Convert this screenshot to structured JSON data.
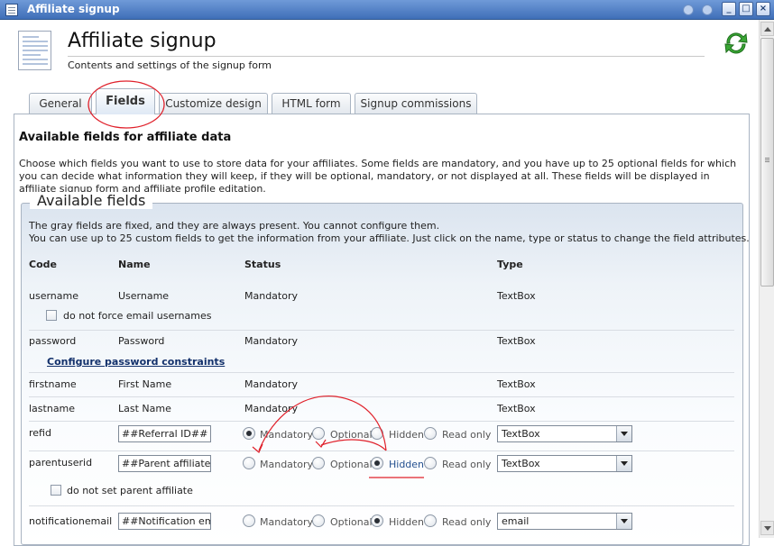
{
  "window": {
    "title": "Affiliate signup"
  },
  "header": {
    "title": "Affiliate signup",
    "subtitle": "Contents and settings of the signup form"
  },
  "tabs": [
    {
      "label": "General"
    },
    {
      "label": "Fields",
      "active": true
    },
    {
      "label": "Customize design"
    },
    {
      "label": "HTML form"
    },
    {
      "label": "Signup commissions"
    }
  ],
  "section": {
    "title": "Available fields for affiliate data",
    "description": "Choose which fields you want to use to store data for your affiliates. Some fields are mandatory, and you have up to 25 optional fields for which you can decide what information they will keep, if they will be optional, mandatory, or not displayed at all. These fields will be displayed in affiliate signup form and affiliate profile editation."
  },
  "fieldset": {
    "legend": "Available fields",
    "note_line1": "The gray fields are fixed, and they are always present. You cannot configure them.",
    "note_line2": "You can use up to 25 custom fields to get the information from your affiliate. Just click on the name, type or status to change the field attributes."
  },
  "table": {
    "headers": {
      "code": "Code",
      "name": "Name",
      "status": "Status",
      "type": "Type"
    },
    "fixed_rows": [
      {
        "code": "username",
        "name": "Username",
        "status": "Mandatory",
        "type": "TextBox"
      },
      {
        "code": "password",
        "name": "Password",
        "status": "Mandatory",
        "type": "TextBox"
      },
      {
        "code": "firstname",
        "name": "First Name",
        "status": "Mandatory",
        "type": "TextBox"
      },
      {
        "code": "lastname",
        "name": "Last Name",
        "status": "Mandatory",
        "type": "TextBox"
      }
    ],
    "username_checkbox_label": "do not force email usernames",
    "password_link": "Configure password constraints",
    "custom_rows": [
      {
        "code": "refid",
        "name_value": "##Referral ID##",
        "selected_status": "Mandatory",
        "type": "TextBox"
      },
      {
        "code": "parentuserid",
        "name_value": "##Parent affiliate##",
        "selected_status": "Hidden",
        "type": "TextBox"
      },
      {
        "code": "notificationemail",
        "name_value": "##Notification email##",
        "selected_status": "Hidden",
        "type": "email"
      }
    ],
    "parent_checkbox_label": "do not set parent affiliate",
    "status_options": [
      "Mandatory",
      "Optional",
      "Hidden",
      "Read only"
    ]
  },
  "colors": {
    "titlebar": "#4a7bc4",
    "annotation": "#e0202a",
    "link": "#12306b"
  }
}
